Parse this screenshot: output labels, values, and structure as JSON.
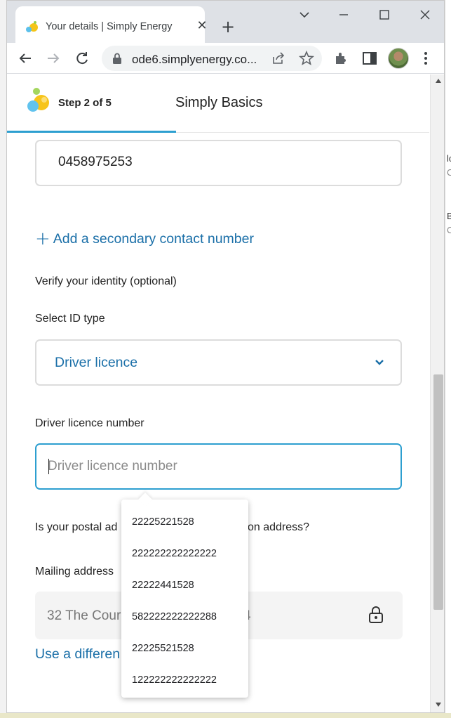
{
  "browser": {
    "tab_title": "Your details | Simply Energy",
    "url": "ode6.simplyenergy.co..."
  },
  "background": {
    "fragments": [
      "lc",
      "C",
      "B:",
      "C"
    ]
  },
  "stepper": {
    "step_label": "Step 2 of 5",
    "plan_name": "Simply Basics",
    "progress_fraction": 0.4
  },
  "form": {
    "phone_value": "0458975253",
    "add_secondary_label": "Add a secondary contact number",
    "verify_heading": "Verify your identity (optional)",
    "id_type_label": "Select ID type",
    "id_type_value": "Driver licence",
    "licence_label": "Driver licence number",
    "licence_placeholder": "Driver licence number",
    "postal_question_start": "Is your postal ad",
    "postal_question_end": "on address?",
    "mailing_label": "Mailing address",
    "mailing_value_start": "32 The Cour",
    "mailing_value_end": "4",
    "different_link": "Use a differen"
  },
  "autofill": {
    "suggestions": [
      "22225221528",
      "222222222222222",
      "22222441528",
      "582222222222288",
      "22225521528",
      "122222222222222"
    ]
  },
  "colors": {
    "brand_blue": "#1a6fa8",
    "accent": "#2d9fd0"
  }
}
